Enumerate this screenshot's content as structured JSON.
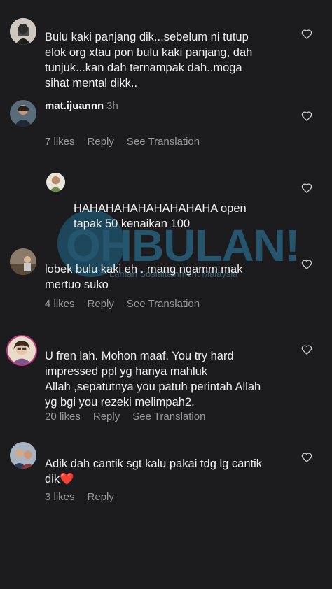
{
  "comments": [
    {
      "username": "",
      "time": "",
      "text": "Bulu kaki panjang dik...sebelum ni tutup\nelok org xtau pon bulu kaki panjang, dah\ntunjuk...kan dah ternampak dah..moga\nsihat mental dikk..",
      "likes": "",
      "reply": "",
      "translate": ""
    },
    {
      "username": "mat.ijuannn",
      "time": "3h",
      "text": "",
      "likes": "7 likes",
      "reply": "Reply",
      "translate": "See Translation"
    },
    {
      "username": "",
      "time": "",
      "text": "HAHAHAHAHAHAHAHAHA open\ntapak 50 kenaikan 100",
      "likes": "",
      "reply": "",
      "translate": ""
    },
    {
      "username": "",
      "time": "",
      "text": "lobek bulu kaki eh . mang ngamm mak\nmertuo suko",
      "likes": "4 likes",
      "reply": "Reply",
      "translate": "See Translation"
    },
    {
      "username": "",
      "time": "",
      "text": "U fren lah. Mohon maaf. You try hard\nimpressed ppl yg hanya mahluk\nAllah ,sepatutnya you patuh perintah Allah\nyg bgi you rezeki melimpah2.",
      "likes": "20 likes",
      "reply": "Reply",
      "translate": "See Translation"
    },
    {
      "username": "",
      "time": "",
      "text": "Adik dah cantik sgt kalu pakai tdg lg cantik\ndik❤️",
      "likes": "3 likes",
      "reply": "Reply",
      "translate": ""
    }
  ],
  "watermark": {
    "logo": "OHBULAN!",
    "tagline": "Laman Sosialtainment Malaysia"
  },
  "icons": {
    "like": "heart-outline-icon"
  },
  "colors": {
    "background": "#1c1c1e",
    "text": "#f0f0f0",
    "muted": "#9a9a9a",
    "watermark": "#2d86b0"
  }
}
